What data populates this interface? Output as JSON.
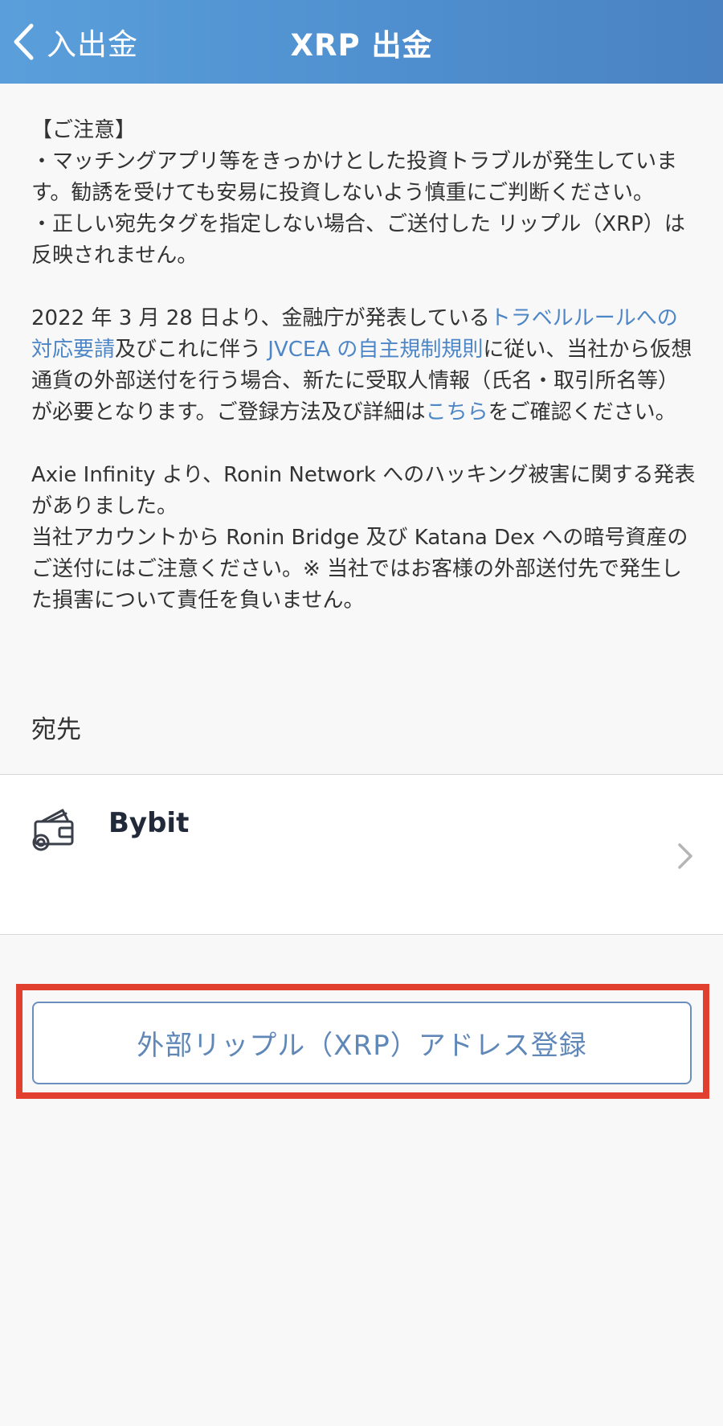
{
  "header": {
    "back_label": "入出金",
    "title": "XRP 出金"
  },
  "notice": {
    "heading": "【ご注意】",
    "line1": "・マッチングアプリ等をきっかけとした投資トラブルが発生しています。勧誘を受けても安易に投資しないよう慎重にご判断ください。",
    "line2": "・正しい宛先タグを指定しない場合、ご送付した リップル（XRP）は反映されません。",
    "travel_rule": {
      "part1": "2022 年 3 月 28 日より、金融庁が発表している",
      "link1": "トラベルルールへの対応要請",
      "part2": "及びこれに伴う ",
      "link2": "JVCEA の自主規制規則",
      "part3": "に従い、当社から仮想通貨の外部送付を行う場合、新たに受取人情報（氏名・取引所名等）が必要となります。ご登録方法及び詳細は",
      "link3": "こちら",
      "part4": "をご確認ください。"
    },
    "ronin_line1": "Axie Infinity より、Ronin Network へのハッキング被害に関する発表がありました。",
    "ronin_line2": "当社アカウントから Ronin Bridge 及び Katana Dex への暗号資産のご送付にはご注意ください。※ 当社ではお客様の外部送付先で発生した損害について責任を負いません。"
  },
  "destination": {
    "label": "宛先",
    "item": {
      "name": "Bybit",
      "icon": "wallet-icon"
    }
  },
  "actions": {
    "add_address_label": "外部リップル（XRP）アドレス登録"
  },
  "colors": {
    "header_start": "#5a9fdb",
    "header_end": "#4a82c2",
    "link": "#4d86c6",
    "highlight": "#e2402f",
    "button_text": "#5f88b8"
  }
}
